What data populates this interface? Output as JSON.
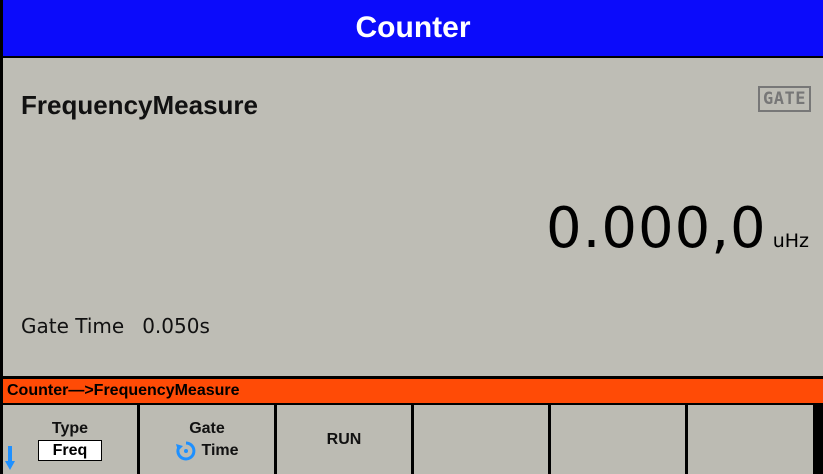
{
  "window": {
    "title": "Counter"
  },
  "main": {
    "measure_name": "FrequencyMeasure",
    "gate_badge": "GATE",
    "value": "0.000,0",
    "unit": "uHz",
    "gate_time_label": "Gate Time",
    "gate_time_value": "0.050s"
  },
  "status": {
    "breadcrumb": "Counter—>FrequencyMeasure"
  },
  "softkeys": [
    {
      "top": "Type",
      "bottom": "Freq",
      "icon": "down-arrow-icon"
    },
    {
      "top": "Gate",
      "bottom": "Time",
      "icon": "rotate-icon"
    },
    {
      "label": "RUN"
    },
    {
      "label": ""
    },
    {
      "label": ""
    },
    {
      "label": ""
    }
  ],
  "colors": {
    "title_bar": "#0b0bfb",
    "status_bar": "#ff4b06",
    "background": "#bebdb5",
    "icon_blue": "#1e90ff"
  }
}
